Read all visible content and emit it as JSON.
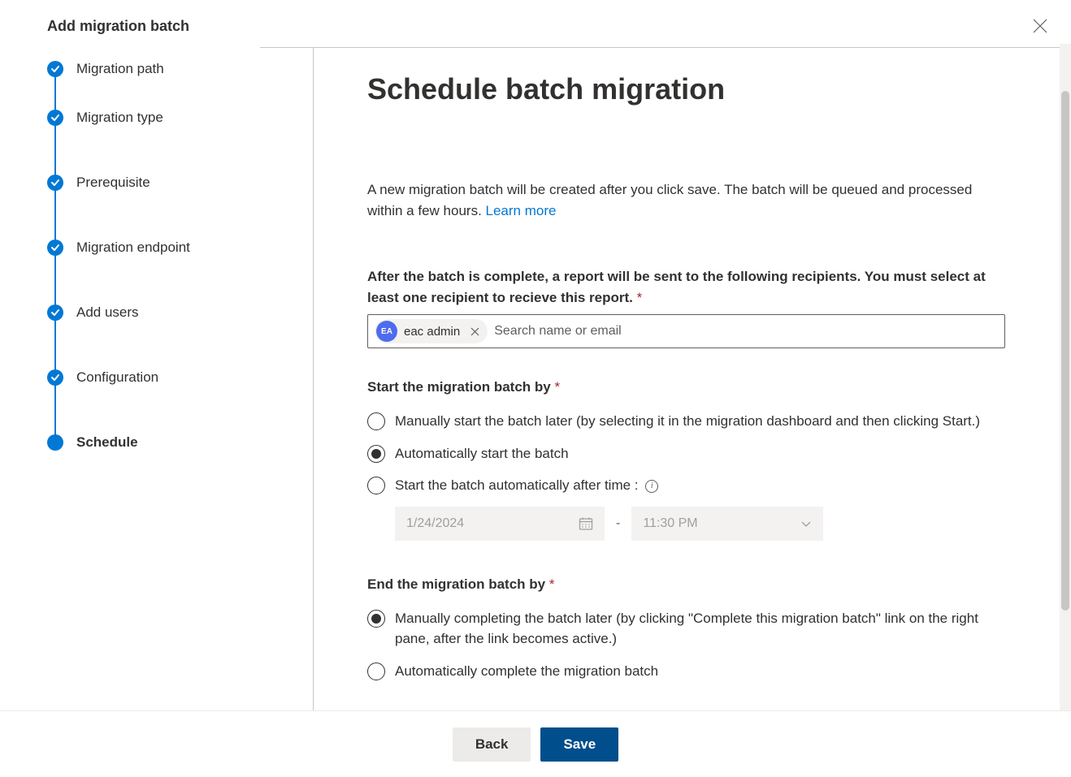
{
  "header": {
    "title": "Add migration batch"
  },
  "steps": [
    {
      "label": "Migration path",
      "state": "done"
    },
    {
      "label": "Migration type",
      "state": "done"
    },
    {
      "label": "Prerequisite",
      "state": "done"
    },
    {
      "label": "Migration endpoint",
      "state": "done"
    },
    {
      "label": "Add users",
      "state": "done"
    },
    {
      "label": "Configuration",
      "state": "done"
    },
    {
      "label": "Schedule",
      "state": "current"
    }
  ],
  "main": {
    "title": "Schedule batch migration",
    "description": "A new migration batch will be created after you click save. The batch will be queued and processed within a few hours. ",
    "learn_more": "Learn more",
    "recipients_label": "After the batch is complete, a report will be sent to the following recipients. You must select at least one recipient to recieve this report.",
    "recipient_chip": {
      "initials": "EA",
      "name": "eac admin"
    },
    "recipient_placeholder": "Search name or email",
    "start_label": "Start the migration batch by",
    "start_options": {
      "manual": "Manually start the batch later (by selecting it in the migration dashboard and then clicking Start.)",
      "auto": "Automatically start the batch",
      "after": "Start the batch automatically after time :"
    },
    "start_date": "1/24/2024",
    "start_time": "11:30 PM",
    "end_label": "End the migration batch by",
    "end_options": {
      "manual": "Manually completing the batch later (by clicking \"Complete this migration batch\" link on the right pane, after the link becomes active.)",
      "auto": "Automatically complete the migration batch"
    }
  },
  "footer": {
    "back": "Back",
    "save": "Save"
  }
}
